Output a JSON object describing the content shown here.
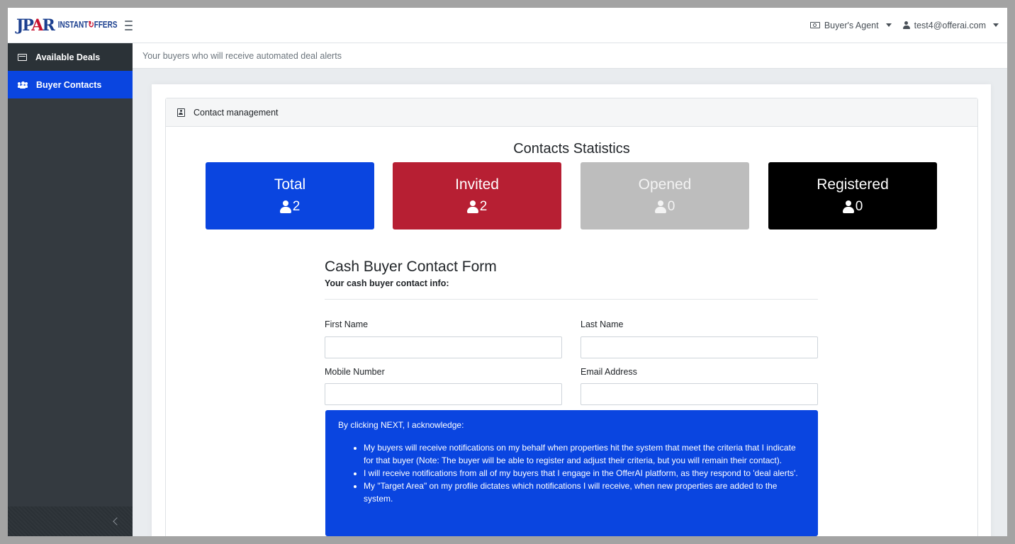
{
  "brand": {
    "logo_text": "JPAR",
    "logo_sub": "INSTANT OFFERS"
  },
  "navbar": {
    "role_label": "Buyer's Agent",
    "user_email": "test4@offerai.com"
  },
  "sidebar": {
    "items": [
      {
        "label": "Available Deals",
        "icon": "deals-icon",
        "active": false
      },
      {
        "label": "Buyer Contacts",
        "icon": "users-icon",
        "active": true
      }
    ]
  },
  "page": {
    "subtitle": "Your buyers who will receive automated deal alerts"
  },
  "card": {
    "header": "Contact management"
  },
  "stats": {
    "title": "Contacts Statistics",
    "items": [
      {
        "label": "Total",
        "count": "2",
        "color": "#0a45e0"
      },
      {
        "label": "Invited",
        "count": "2",
        "color": "#b71f33"
      },
      {
        "label": "Opened",
        "count": "0",
        "color": "#bdbdbd"
      },
      {
        "label": "Registered",
        "count": "0",
        "color": "#000000"
      }
    ]
  },
  "form": {
    "title": "Cash Buyer Contact Form",
    "subtitle": "Your cash buyer contact info:",
    "fields": {
      "first_name": {
        "label": "First Name",
        "value": ""
      },
      "last_name": {
        "label": "Last Name",
        "value": ""
      },
      "mobile": {
        "label": "Mobile Number",
        "value": ""
      },
      "email": {
        "label": "Email Address",
        "value": ""
      }
    },
    "ack": {
      "intro": "By clicking NEXT, I acknowledge:",
      "items": [
        "My buyers will receive notifications on my behalf when properties hit the system that meet the criteria that I indicate for that buyer (Note: The buyer will be able to register and adjust their criteria, but you will remain their contact).",
        "I will receive notifications from all of my buyers that I engage in the OfferAI platform, as they respond to 'deal alerts'.",
        "My \"Target Area\" on my profile dictates which notifications I will receive, when new properties are added to the system."
      ]
    }
  }
}
